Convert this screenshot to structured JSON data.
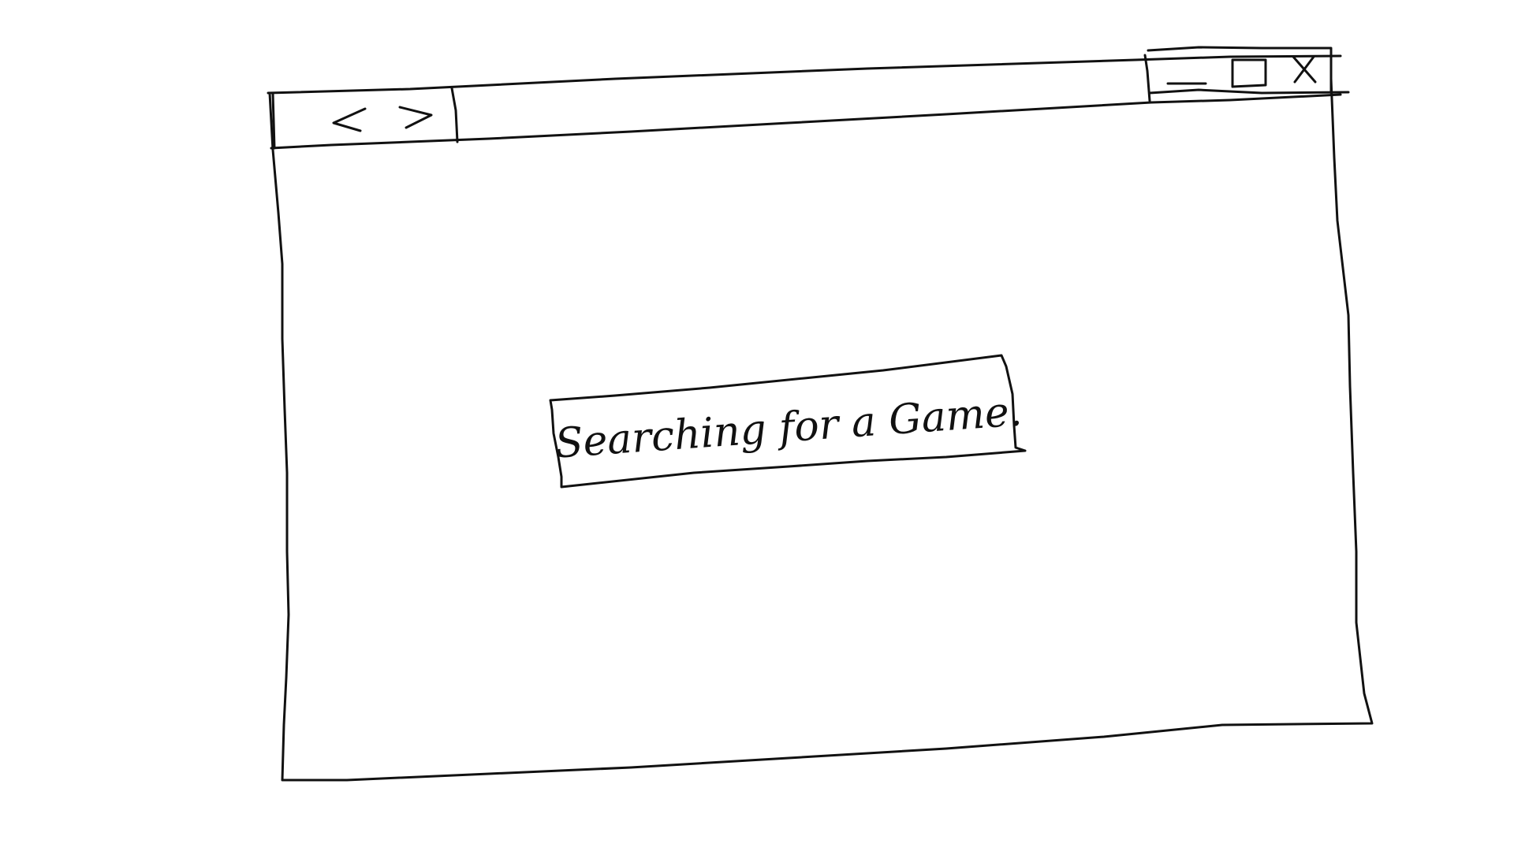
{
  "window": {
    "controls": {
      "minimize_icon": "minimize-icon",
      "maximize_icon": "maximize-icon",
      "close_icon": "close-icon"
    },
    "navigation": {
      "back_icon": "chevron-left-icon",
      "forward_icon": "chevron-right-icon"
    }
  },
  "main": {
    "status_text": "Searching for a Game."
  }
}
